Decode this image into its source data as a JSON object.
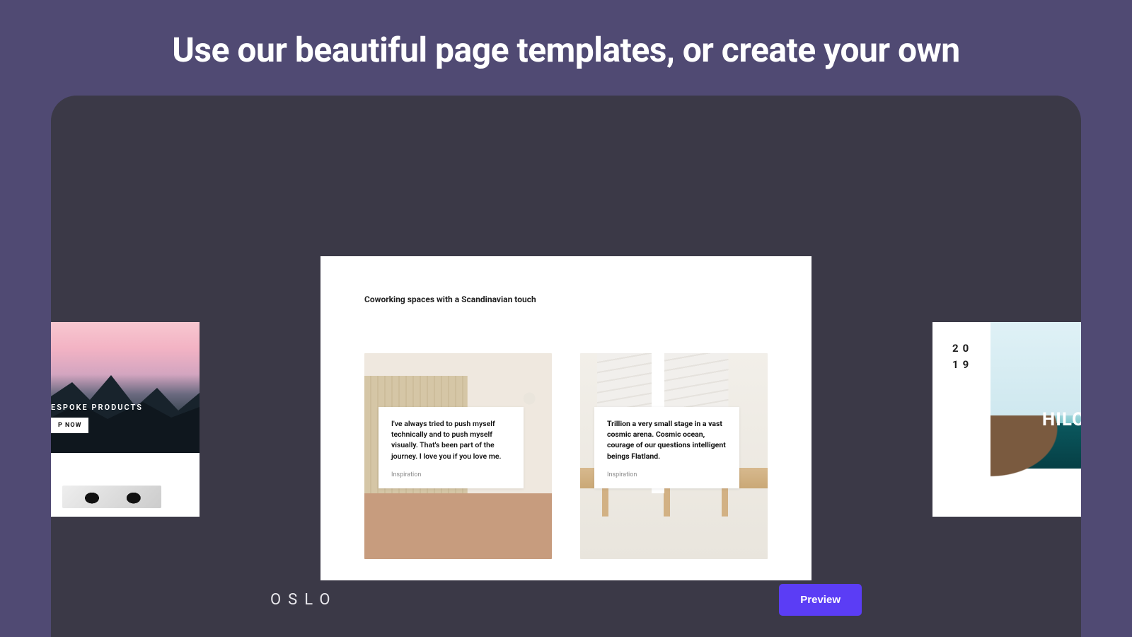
{
  "hero": {
    "title": "Use our beautiful page templates, or create your own"
  },
  "left_template": {
    "overlay_text": "ESPOKE PRODUCTS",
    "cta_label": "P NOW"
  },
  "center_template": {
    "heading": "Coworking spaces with a Scandinavian touch",
    "cards": [
      {
        "body": "I've always tried to push myself technically and to push myself visually. That's been part of the journey. I love you if you love me.",
        "tag": "Inspiration"
      },
      {
        "body": "Trillion a very small stage in a vast cosmic arena. Cosmic ocean, courage of our questions intelligent beings Flatland.",
        "tag": "Inspiration"
      }
    ]
  },
  "right_template": {
    "year_line1": "20",
    "year_line2": "19",
    "title_fragment": "HILO"
  },
  "footer": {
    "template_name": "OSLO",
    "preview_label": "Preview"
  }
}
